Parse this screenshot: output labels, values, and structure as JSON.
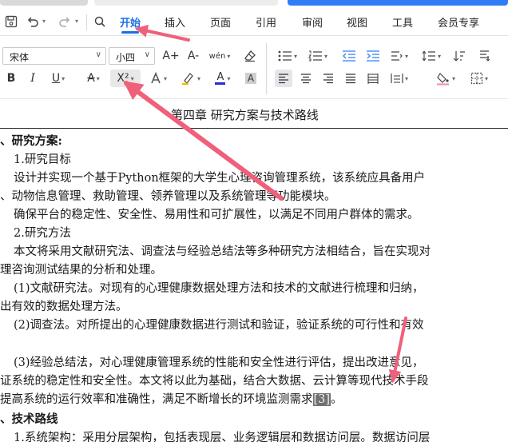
{
  "window": {
    "tabs": [
      {
        "name": "ribbon-tab-home",
        "label": "开始",
        "active": true
      },
      {
        "name": "ribbon-tab-insert",
        "label": "插入"
      },
      {
        "name": "ribbon-tab-layout",
        "label": "页面"
      },
      {
        "name": "ribbon-tab-references",
        "label": "引用"
      },
      {
        "name": "ribbon-tab-review",
        "label": "审阅"
      },
      {
        "name": "ribbon-tab-view",
        "label": "视图"
      },
      {
        "name": "ribbon-tab-tools",
        "label": "工具"
      },
      {
        "name": "ribbon-tab-member",
        "label": "会员专享"
      }
    ]
  },
  "toolbar": {
    "font_family": "宋体",
    "font_size": "小四",
    "grow_font_label": "A+",
    "shrink_font_label": "A-",
    "phonetic_label": "wén",
    "bold_label": "B",
    "italic_label": "I",
    "underline_label": "U",
    "strike_label": "A",
    "superscript_label": "X²",
    "font_color_label": "A",
    "char_shade_label": "A"
  },
  "icons": {
    "save": "save-icon",
    "undo": "undo-icon",
    "redo": "redo-icon",
    "clear_format": "eraser-icon",
    "highlight": "highlighter-icon"
  },
  "colors": {
    "accent": "#1f6fe5",
    "font_color_bar": "#2b2bd9",
    "arrow": "#f0607a",
    "citation_highlight": "#707070"
  },
  "document": {
    "title": "第四章  研究方案与技术路线",
    "lines": [
      "、研究方案:",
      "1.研究目标",
      "设计并实现一个基于Python框架的大学生心理咨询管理系统，该系统应具备用户",
      "、动物信息管理、救助管理、领养管理以及系统管理等功能模块。",
      "确保平台的稳定性、安全性、易用性和可扩展性，以满足不同用户群体的需求。",
      "2.研究方法",
      "本文将采用文献研究法、调查法与经验总结法等多种研究方法相结合，旨在实现对",
      "理咨询测试结果的分析和处理。",
      "(1)文献研究法。对现有的心理健康数据处理方法和技术的文献进行梳理和归纳，",
      "出有效的数据处理方法。",
      "(2)调查法。对所提出的心理健康数据进行测试和验证，验证系统的可行性和有效",
      "(3)经验总结法，对心理健康管理系统的性能和安全性进行评估，提出改进意见，",
      "证系统的稳定性和安全性。本文将以此为基础，结合大数据、云计算等现代技术手段",
      "提高系统的运行效率和准确性，满足不断增长的环境监测需求",
      "[3]",
      "。",
      "、技术路线",
      "1.系统架构：采用分层架构，包括表现层、业务逻辑层和数据访问层。数据访问层"
    ]
  }
}
